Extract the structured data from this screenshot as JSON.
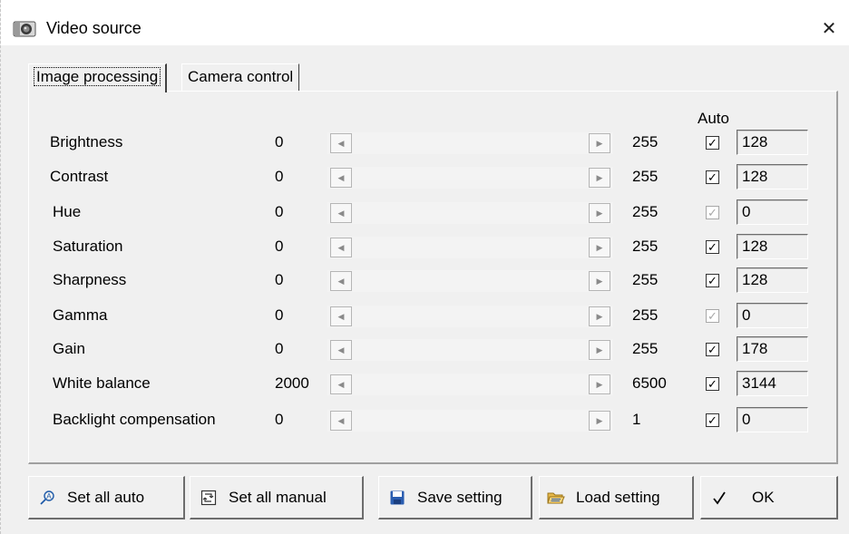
{
  "window": {
    "title": "Video source",
    "close_glyph": "✕"
  },
  "tabs": [
    {
      "label": "Image processing",
      "active": true
    },
    {
      "label": "Camera control",
      "active": false
    }
  ],
  "auto_header": "Auto",
  "rows": [
    {
      "label": "Brightness",
      "min": "0",
      "max": "255",
      "auto": true,
      "enabled": true,
      "value": "128",
      "slider_fraction": 0.502
    },
    {
      "label": "Contrast",
      "min": "0",
      "max": "255",
      "auto": true,
      "enabled": true,
      "value": "128",
      "slider_fraction": 0.502
    },
    {
      "label": "Hue",
      "min": "0",
      "max": "255",
      "auto": true,
      "enabled": false,
      "value": "0",
      "slider_fraction": 0
    },
    {
      "label": "Saturation",
      "min": "0",
      "max": "255",
      "auto": true,
      "enabled": true,
      "value": "128",
      "slider_fraction": 0.502
    },
    {
      "label": "Sharpness",
      "min": "0",
      "max": "255",
      "auto": true,
      "enabled": true,
      "value": "128",
      "slider_fraction": 0.502
    },
    {
      "label": "Gamma",
      "min": "0",
      "max": "255",
      "auto": true,
      "enabled": false,
      "value": "0",
      "slider_fraction": 0
    },
    {
      "label": "Gain",
      "min": "0",
      "max": "255",
      "auto": true,
      "enabled": true,
      "value": "178",
      "slider_fraction": 0.698
    },
    {
      "label": "White balance",
      "min": "2000",
      "max": "6500",
      "auto": true,
      "enabled": true,
      "value": "3144",
      "slider_fraction": 0.254
    },
    {
      "label": "Backlight compensation",
      "min": "0",
      "max": "1",
      "auto": true,
      "enabled": true,
      "value": "0",
      "slider_fraction": 0
    }
  ],
  "buttons": {
    "set_all_auto": {
      "label": "Set all auto",
      "icon": "auto-wand-icon"
    },
    "set_all_manual": {
      "label": "Set all manual",
      "icon": "manual-icon"
    },
    "save_setting": {
      "label": "Save setting",
      "icon": "floppy-disk-icon"
    },
    "load_setting": {
      "label": "Load setting",
      "icon": "folder-open-icon"
    },
    "ok": {
      "label": "OK",
      "icon": "checkmark-icon"
    }
  },
  "colors": {
    "window_bg": "#f0f0f0",
    "title_bg": "#ffffff",
    "accent_blue": "#1e5aa8"
  }
}
